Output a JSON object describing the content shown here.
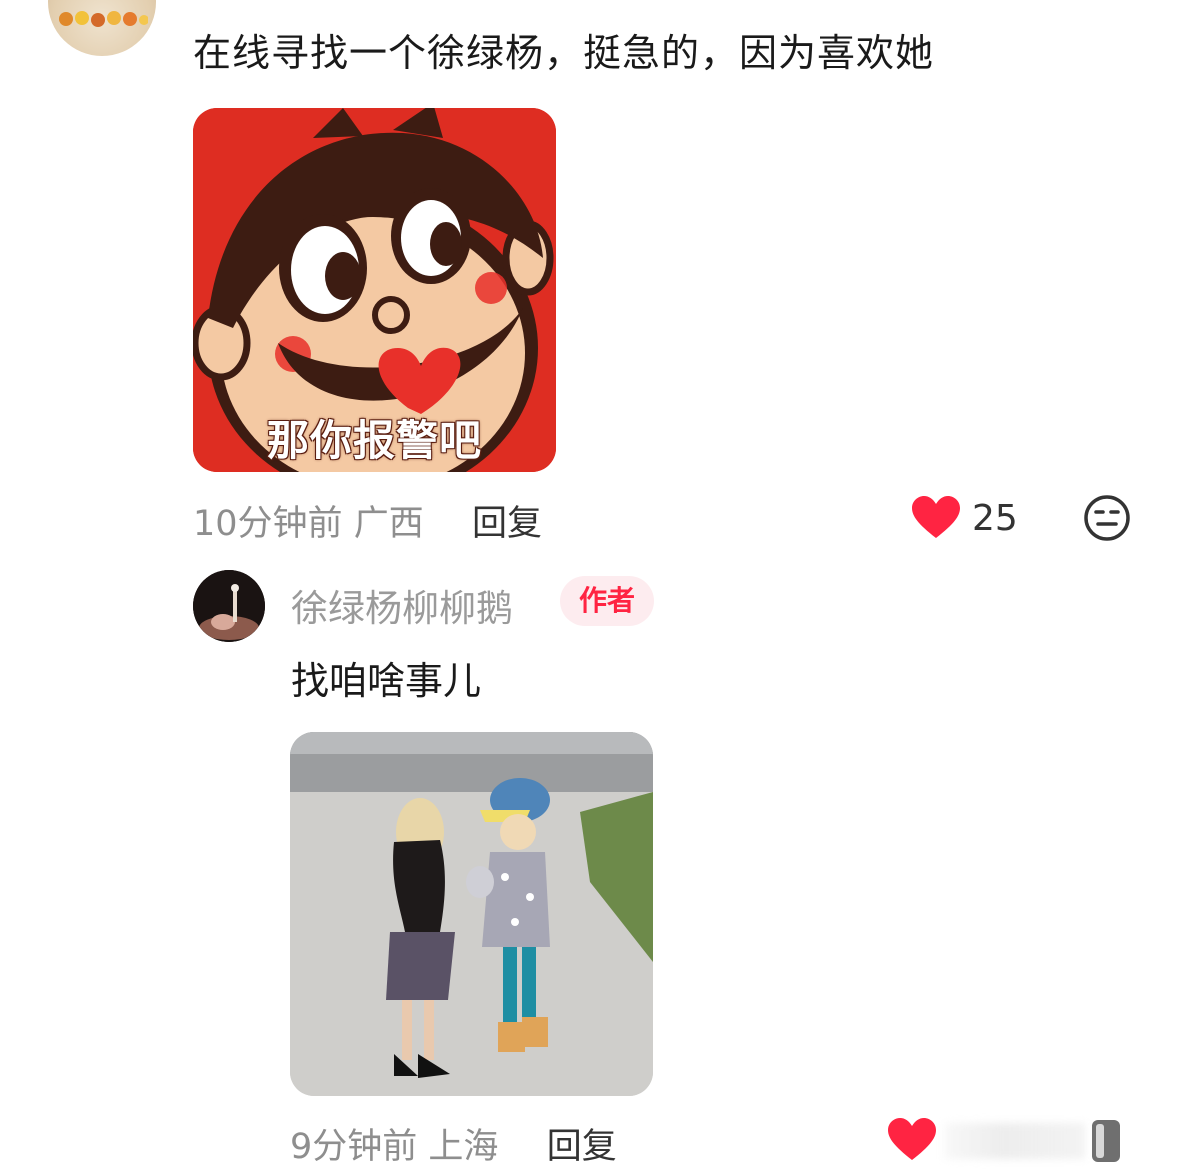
{
  "top_comment": {
    "text": "在线寻找一个徐绿杨，挺急的，因为喜欢她",
    "sticker_caption": "那你报警吧",
    "time": "10分钟前",
    "location": "广西",
    "reply_label": "回复",
    "like_count": "25",
    "like_icon": "heart-icon",
    "extra_icon": "meh-face-icon"
  },
  "reply": {
    "username": "徐绿杨柳柳鹅",
    "badge": "作者",
    "text": "找咱啥事儿",
    "time": "9分钟前",
    "location": "上海",
    "reply_label": "回复",
    "like_icon": "heart-icon"
  },
  "colors": {
    "heart": "#ff2442",
    "badge_text": "#ff2442",
    "badge_bg": "#fdecef",
    "meta_text": "#8e8e8e"
  }
}
